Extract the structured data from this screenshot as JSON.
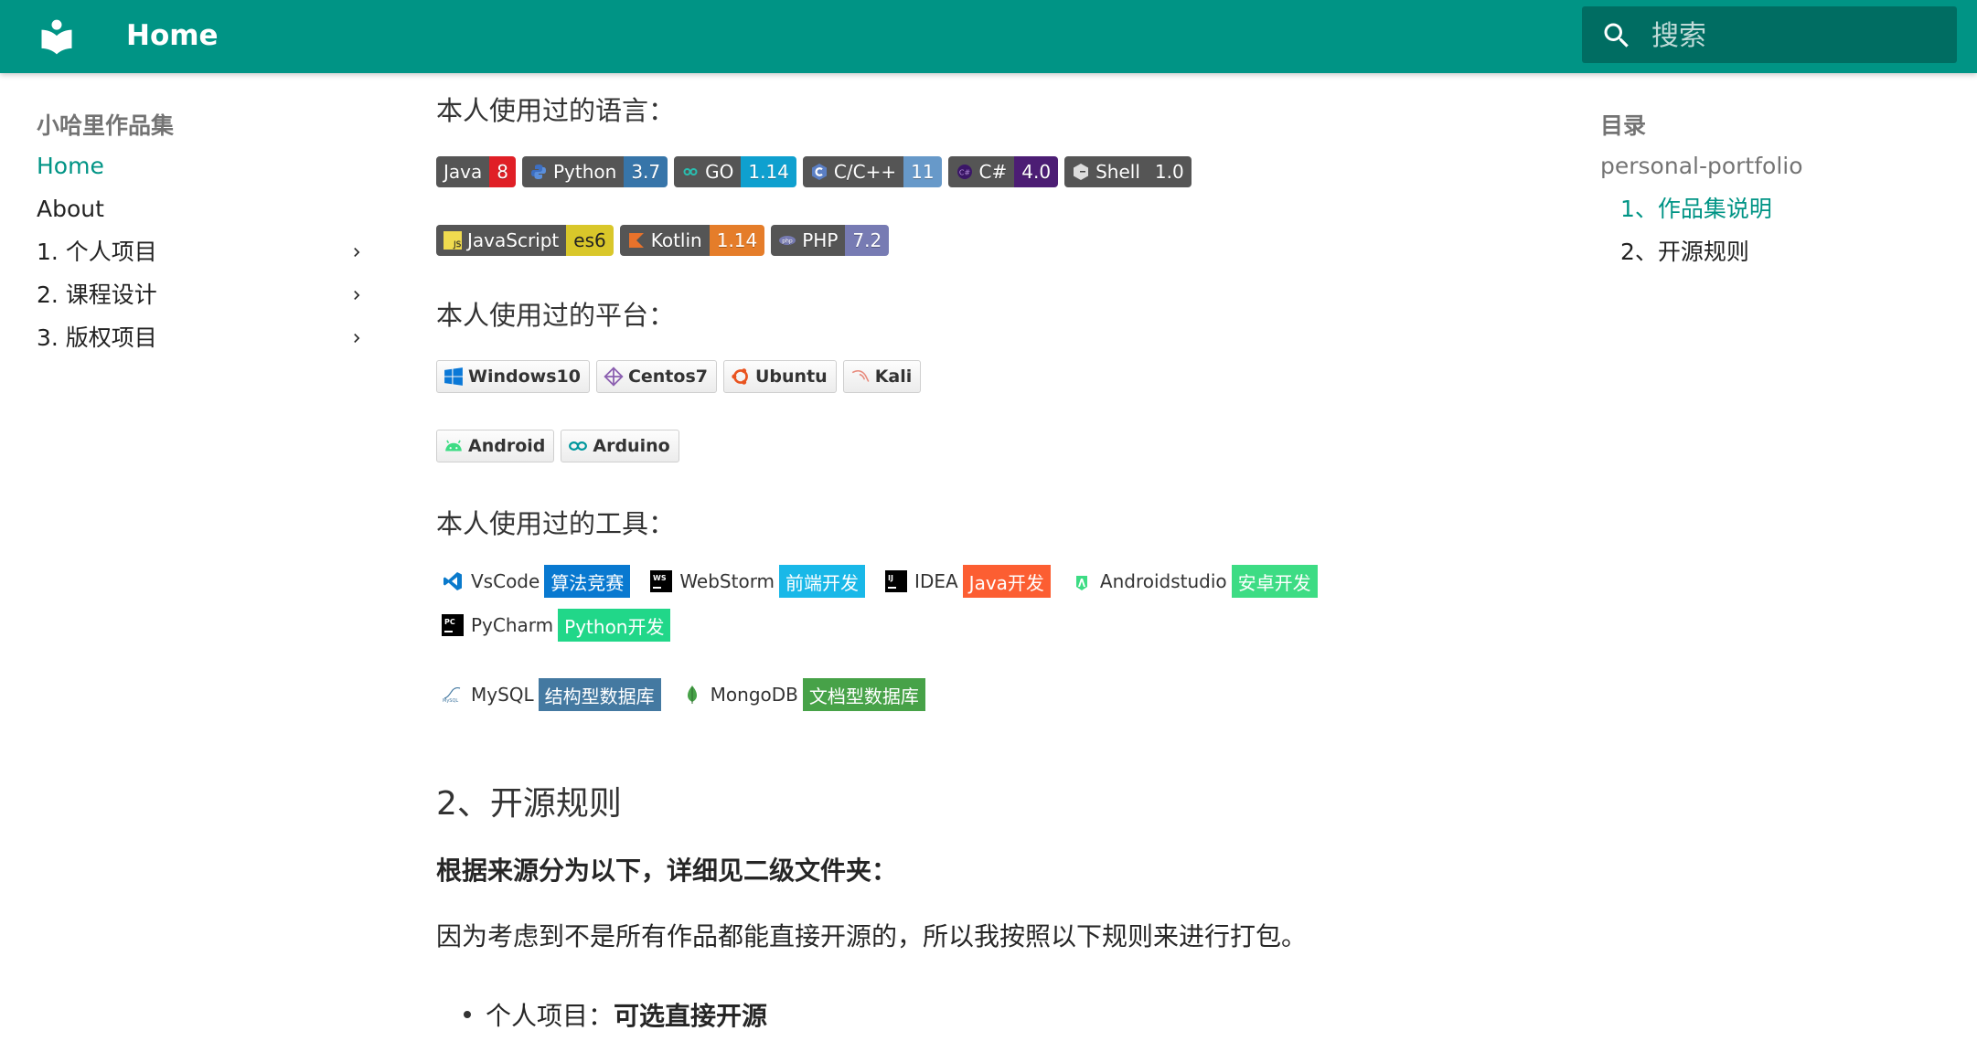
{
  "header": {
    "title": "Home",
    "search_placeholder": "搜索",
    "brand_color": "#009485"
  },
  "nav": {
    "title": "小哈里作品集",
    "items": [
      {
        "label": "Home",
        "active": true
      },
      {
        "label": "About"
      },
      {
        "label": "1. 个人项目",
        "expandable": true
      },
      {
        "label": "2. 课程设计",
        "expandable": true
      },
      {
        "label": "3. 版权项目",
        "expandable": true
      }
    ]
  },
  "toc": {
    "title": "目录",
    "items": [
      {
        "label": "personal-portfolio"
      },
      {
        "label": "1、作品集说明",
        "active": true
      },
      {
        "label": "2、开源规则"
      }
    ]
  },
  "main": {
    "languages_heading": "本人使用过的语言：",
    "languages": [
      {
        "label": "Java",
        "value": "8",
        "color": "#e01f26",
        "icon": "java-icon"
      },
      {
        "label": "Python",
        "value": "3.7",
        "color": "#3775a9",
        "icon": "python-icon"
      },
      {
        "label": "GO",
        "value": "1.14",
        "color": "#0fa0cf",
        "icon": "go-icon"
      },
      {
        "label": "C/C++",
        "value": "11",
        "color": "#6799c9",
        "icon": "cpp-icon"
      },
      {
        "label": "C#",
        "value": "4.0",
        "color": "#4c1d74",
        "icon": "csharp-icon"
      },
      {
        "label": "Shell",
        "value": "1.0",
        "color": "#555555",
        "icon": "shell-icon"
      },
      {
        "label": "JavaScript",
        "value": "es6",
        "color": "#d9c72a",
        "icon": "javascript-icon"
      },
      {
        "label": "Kotlin",
        "value": "1.14",
        "color": "#e57d2a",
        "icon": "kotlin-icon"
      },
      {
        "label": "PHP",
        "value": "7.2",
        "color": "#777bb3",
        "icon": "php-icon"
      }
    ],
    "platforms_heading": "本人使用过的平台：",
    "platforms": [
      {
        "label": "Windows10",
        "icon": "windows-icon"
      },
      {
        "label": "Centos7",
        "icon": "centos-icon"
      },
      {
        "label": "Ubuntu",
        "icon": "ubuntu-icon"
      },
      {
        "label": "Kali",
        "icon": "kali-icon"
      },
      {
        "label": "Android",
        "icon": "android-icon"
      },
      {
        "label": "Arduino",
        "icon": "arduino-icon"
      }
    ],
    "tools_heading": "本人使用过的工具：",
    "tools": [
      {
        "label": "VsCode",
        "value": "算法竞赛",
        "color": "#0979d0",
        "icon": "vscode-icon"
      },
      {
        "label": "WebStorm",
        "value": "前端开发",
        "color": "#19b8e8",
        "icon": "webstorm-icon"
      },
      {
        "label": "IDEA",
        "value": "Java开发",
        "color": "#fc5e32",
        "icon": "idea-icon"
      },
      {
        "label": "Androidstudio",
        "value": "安卓开发",
        "color": "#3ddc84",
        "icon": "androidstudio-icon"
      },
      {
        "label": "PyCharm",
        "value": "Python开发",
        "color": "#21d789",
        "icon": "pycharm-icon"
      },
      {
        "label": "MySQL",
        "value": "结构型数据库",
        "color": "#4479a1",
        "icon": "mysql-icon"
      },
      {
        "label": "MongoDB",
        "value": "文档型数据库",
        "color": "#47a248",
        "icon": "mongodb-icon"
      }
    ],
    "section2_heading": "2、开源规则",
    "section2_bold": "根据来源分为以下，详细见二级文件夹：",
    "section2_paragraph": "因为考虑到不是所有作品都能直接开源的，所以我按照以下规则来进行打包。",
    "bullet_label": "个人项目：",
    "bullet_value": "可选直接开源"
  }
}
